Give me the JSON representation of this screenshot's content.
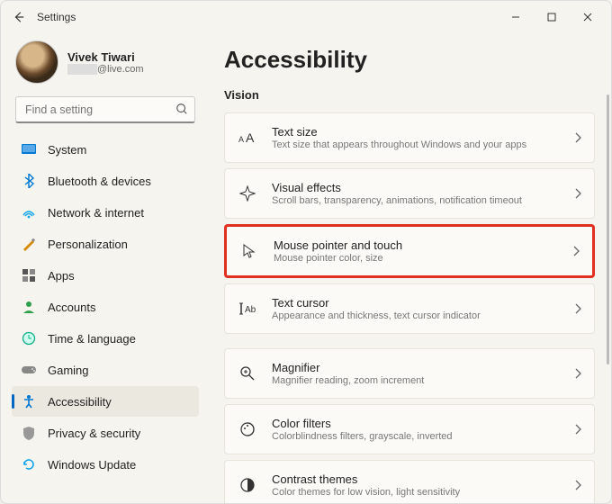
{
  "app": {
    "title": "Settings"
  },
  "profile": {
    "name": "Vivek Tiwari",
    "email_suffix": "@live.com"
  },
  "search": {
    "placeholder": "Find a setting"
  },
  "sidebar": {
    "items": [
      {
        "label": "System"
      },
      {
        "label": "Bluetooth & devices"
      },
      {
        "label": "Network & internet"
      },
      {
        "label": "Personalization"
      },
      {
        "label": "Apps"
      },
      {
        "label": "Accounts"
      },
      {
        "label": "Time & language"
      },
      {
        "label": "Gaming"
      },
      {
        "label": "Accessibility"
      },
      {
        "label": "Privacy & security"
      },
      {
        "label": "Windows Update"
      }
    ]
  },
  "page": {
    "title": "Accessibility",
    "section": "Vision",
    "tiles": [
      {
        "title": "Text size",
        "sub": "Text size that appears throughout Windows and your apps"
      },
      {
        "title": "Visual effects",
        "sub": "Scroll bars, transparency, animations, notification timeout"
      },
      {
        "title": "Mouse pointer and touch",
        "sub": "Mouse pointer color, size"
      },
      {
        "title": "Text cursor",
        "sub": "Appearance and thickness, text cursor indicator"
      },
      {
        "title": "Magnifier",
        "sub": "Magnifier reading, zoom increment"
      },
      {
        "title": "Color filters",
        "sub": "Colorblindness filters, grayscale, inverted"
      },
      {
        "title": "Contrast themes",
        "sub": "Color themes for low vision, light sensitivity"
      }
    ]
  }
}
